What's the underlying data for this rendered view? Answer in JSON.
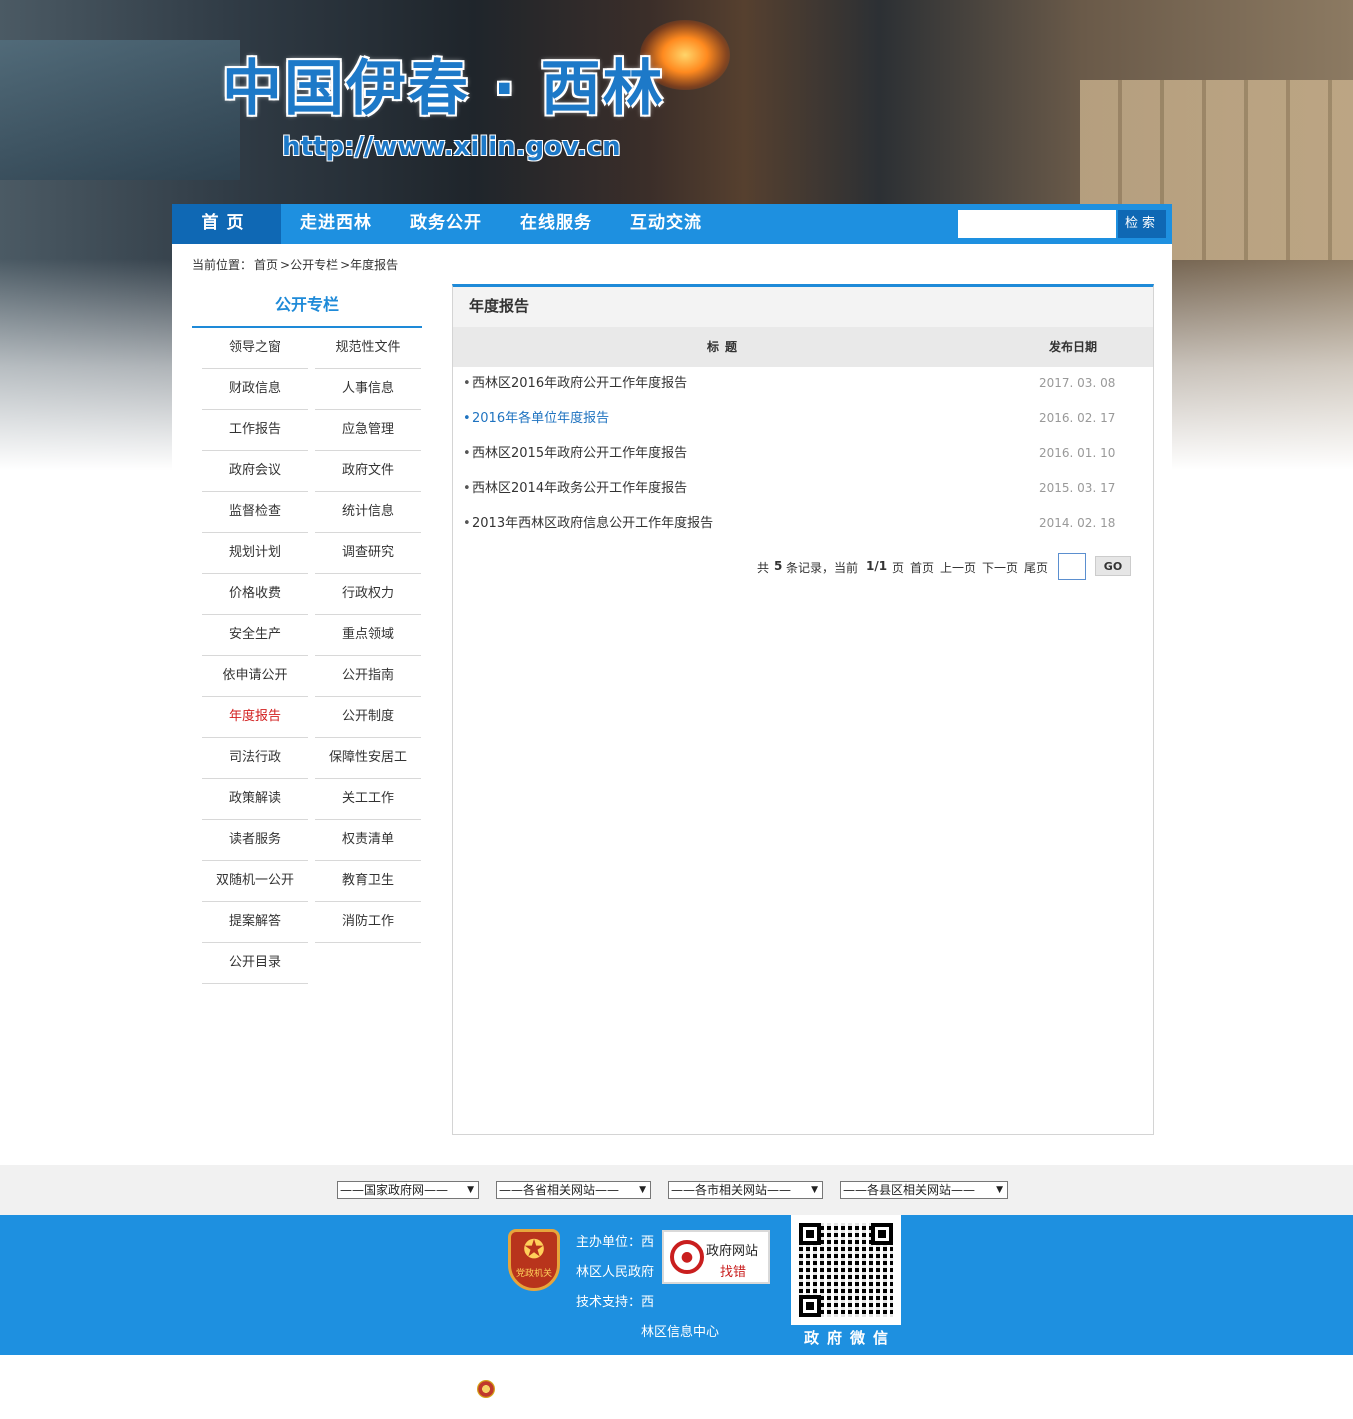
{
  "header": {
    "site_title": "中国伊春 · 西林",
    "site_url": "http://www.xilin.gov.cn"
  },
  "nav": {
    "items": [
      "首页",
      "走进西林",
      "政务公开",
      "在线服务",
      "互动交流"
    ],
    "search_placeholder": "",
    "search_button": "检索"
  },
  "breadcrumb": {
    "prefix": "当前位置：",
    "items": [
      "首页",
      ">公开专栏",
      ">年度报告"
    ]
  },
  "sidebar": {
    "title": "公开专栏",
    "items": [
      "领导之窗",
      "规范性文件",
      "财政信息",
      "人事信息",
      "工作报告",
      "应急管理",
      "政府会议",
      "政府文件",
      "监督检查",
      "统计信息",
      "规划计划",
      "调查研究",
      "价格收费",
      "行政权力",
      "安全生产",
      "重点领域",
      "依申请公开",
      "公开指南",
      "年度报告",
      "公开制度",
      "司法行政",
      "保障性安居工",
      "政策解读",
      "关工工作",
      "读者服务",
      "权责清单",
      "双随机一公开",
      "教育卫生",
      "提案解答",
      "消防工作",
      "公开目录"
    ],
    "active_index": 18
  },
  "content": {
    "heading": "年度报告",
    "col_title": "标题",
    "col_date": "发布日期",
    "rows": [
      {
        "title": "西林区2016年政府公开工作年度报告",
        "date": "2017. 03. 08",
        "highlight": false
      },
      {
        "title": "2016年各单位年度报告",
        "date": "2016. 02. 17",
        "highlight": true
      },
      {
        "title": "西林区2015年政府公开工作年度报告",
        "date": "2016. 01. 10",
        "highlight": false
      },
      {
        "title": "西林区2014年政务公开工作年度报告",
        "date": "2015. 03. 17",
        "highlight": false
      },
      {
        "title": "2013年西林区政府信息公开工作年度报告",
        "date": "2014. 02. 18",
        "highlight": false
      }
    ],
    "pager": {
      "total_prefix": "共",
      "total": "5",
      "total_suffix": "条记录，当前",
      "current": "1/1",
      "page_word": "页",
      "first": "首页",
      "prev": "上一页",
      "next": "下一页",
      "last": "尾页",
      "go": "GO"
    }
  },
  "footer": {
    "link_selects": [
      "——国家政府网——",
      "——各省相关网站——",
      "——各市相关网站——",
      "——各县区相关网站——"
    ],
    "emblem_label": "党政机关",
    "host_line1": "主办单位：西",
    "host_line2": "林区人民政府",
    "tech_line1": "技术支持：西",
    "tech_line2": "林区信息中心",
    "report_line1": "政府网站",
    "report_line2": "找错",
    "wechat_label": "政府微信"
  },
  "colors": {
    "nav_blue": "#1e90e0",
    "nav_home": "#0f68b4",
    "active_red": "#d21e1e",
    "link_blue": "#1f73c0"
  }
}
